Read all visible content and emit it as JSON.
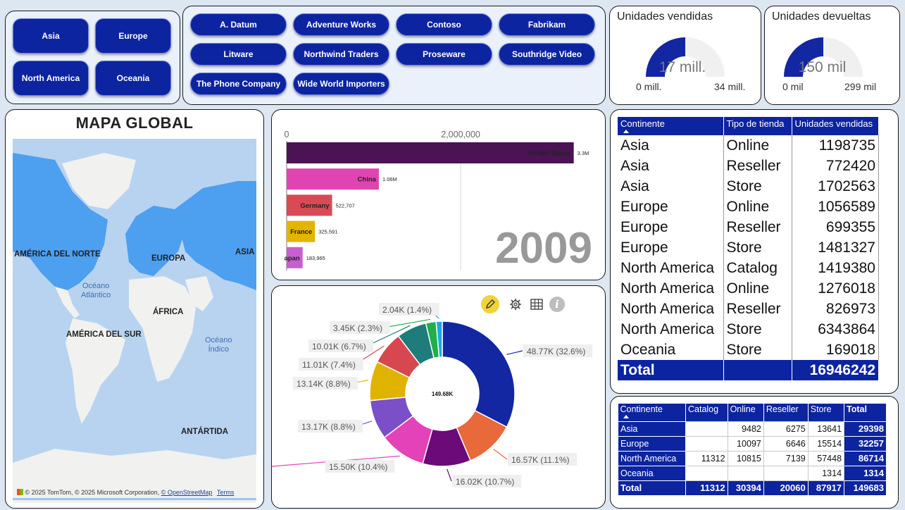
{
  "continent_slicer": [
    "Asia",
    "Europe",
    "North America",
    "Oceania"
  ],
  "brand_slicer": [
    "A. Datum",
    "Adventure Works",
    "Contoso",
    "Fabrikam",
    "Litware",
    "Northwind Traders",
    "Proseware",
    "Southridge Video",
    "The Phone Company",
    "Wide World Importers"
  ],
  "gauges": [
    {
      "title": "Unidades vendidas",
      "value_label": "17 mill.",
      "min_label": "0 mill.",
      "max_label": "34 mill.",
      "fill_fraction": 0.5
    },
    {
      "title": "Unidades devueltas",
      "value_label": "150 mil",
      "min_label": "0 mil",
      "max_label": "299 mil",
      "fill_fraction": 0.5
    }
  ],
  "map": {
    "title": "MAPA GLOBAL",
    "labels": {
      "na": "AMÉRICA DEL NORTE",
      "eu": "EUROPA",
      "asia": "ASIA",
      "africa": "ÁFRICA",
      "sa": "AMÉRICA DEL SUR",
      "ant": "ANTÁRTIDA",
      "atl1": "Océano",
      "atl2": "Atlántico",
      "ind1": "Océano",
      "ind2": "Índico"
    },
    "attribution_brand": "Microsoft Bing",
    "attribution": "© 2025 TomTom, © 2025 Microsoft Corporation,",
    "osm": "© OpenStreetMap",
    "terms": "Terms",
    "colors": {
      "water": "#b7d3f0",
      "land": "#f1f1ef",
      "highlight": "#4d9ff0"
    }
  },
  "chart_data": [
    {
      "type": "bar",
      "orientation": "horizontal",
      "categories": [
        "United States",
        "China",
        "Germany",
        "France",
        "Japan"
      ],
      "category_labels_shown": [
        "United States",
        "China",
        "Germany",
        "France",
        "apan"
      ],
      "values": [
        3300000,
        1060000,
        522707,
        325591,
        183965
      ],
      "value_labels": [
        "3.3M",
        "1.06M",
        "522,707",
        "325,591",
        "183,965"
      ],
      "colors": [
        "#4b1254",
        "#e044b0",
        "#d94a55",
        "#e3b400",
        "#c75fcf"
      ],
      "x_ticks": [
        "0",
        "2,000,000"
      ],
      "xlim": [
        0,
        3400000
      ],
      "year": "2009"
    },
    {
      "type": "pie",
      "donut": true,
      "center_label": "149.68K",
      "values": [
        48770,
        16570,
        16020,
        15500,
        13170,
        13140,
        11010,
        10010,
        3450,
        2040
      ],
      "labels": [
        "48.77K (32.6%)",
        "16.57K (11.1%)",
        "16.02K (10.7%)",
        "15.50K (10.4%)",
        "13.17K (8.8%)",
        "13.14K (8.8%)",
        "11.01K (7.4%)",
        "10.01K (6.7%)",
        "3.45K (2.3%)",
        "2.04K (1.4%)"
      ],
      "colors": [
        "#1327a3",
        "#e8693a",
        "#6b0a78",
        "#e442b8",
        "#7a4fc8",
        "#e0b300",
        "#d7474f",
        "#1e7c7a",
        "#1fb04c",
        "#1aa9e8"
      ]
    }
  ],
  "table1": {
    "headers": [
      "Continente",
      "Tipo de tienda",
      "Unidades vendidas"
    ],
    "rows": [
      [
        "Asia",
        "Online",
        "1198735"
      ],
      [
        "Asia",
        "Reseller",
        "772420"
      ],
      [
        "Asia",
        "Store",
        "1702563"
      ],
      [
        "Europe",
        "Online",
        "1056589"
      ],
      [
        "Europe",
        "Reseller",
        "699355"
      ],
      [
        "Europe",
        "Store",
        "1481327"
      ],
      [
        "North America",
        "Catalog",
        "1419380"
      ],
      [
        "North America",
        "Online",
        "1276018"
      ],
      [
        "North America",
        "Reseller",
        "826973"
      ],
      [
        "North America",
        "Store",
        "6343864"
      ],
      [
        "Oceania",
        "Store",
        "169018"
      ]
    ],
    "total_label": "Total",
    "total_value": "16946242"
  },
  "table2": {
    "headers": [
      "Continente",
      "Catalog",
      "Online",
      "Reseller",
      "Store",
      "Total"
    ],
    "rows": [
      [
        "Asia",
        "",
        "9482",
        "6275",
        "13641",
        "29398"
      ],
      [
        "Europe",
        "",
        "10097",
        "6646",
        "15514",
        "32257"
      ],
      [
        "North America",
        "11312",
        "10815",
        "7139",
        "57448",
        "86714"
      ],
      [
        "Oceania",
        "",
        "",
        "",
        "1314",
        "1314"
      ]
    ],
    "total_row": [
      "Total",
      "11312",
      "30394",
      "20060",
      "87917",
      "149683"
    ]
  },
  "colors": {
    "accent": "#0d24a0",
    "background": "#dde7f2",
    "year": "#999999"
  }
}
